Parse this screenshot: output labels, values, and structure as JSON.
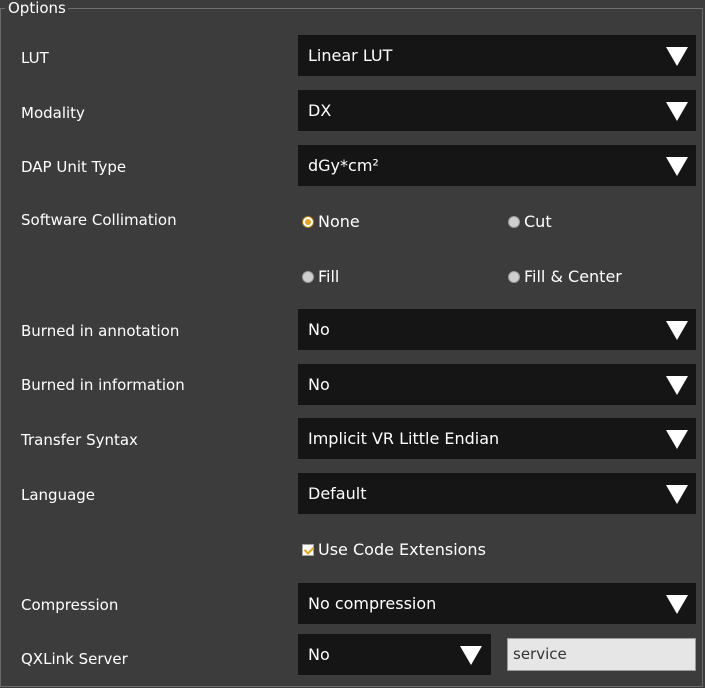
{
  "group": {
    "title": "Options"
  },
  "lut": {
    "label": "LUT",
    "value": "Linear LUT"
  },
  "modality": {
    "label": "Modality",
    "value": "DX"
  },
  "dap_unit": {
    "label": "DAP Unit Type",
    "value": "dGy*cm²"
  },
  "collimation": {
    "label": "Software Collimation",
    "options": [
      "None",
      "Cut",
      "Fill",
      "Fill & Center"
    ],
    "selected": "None"
  },
  "burned_annotation": {
    "label": "Burned in annotation",
    "value": "No"
  },
  "burned_information": {
    "label": "Burned in information",
    "value": "No"
  },
  "transfer_syntax": {
    "label": "Transfer Syntax",
    "value": "Implicit VR Little Endian"
  },
  "language": {
    "label": "Language",
    "value": "Default"
  },
  "code_extensions": {
    "label": "Use Code Extensions",
    "checked": true
  },
  "compression": {
    "label": "Compression",
    "value": "No compression"
  },
  "qxlink": {
    "label": "QXLink Server",
    "value": "No",
    "text": "service"
  },
  "colors": {
    "background": "#3c3c3c",
    "combo": "#151515",
    "accent": "#e8a31c"
  }
}
